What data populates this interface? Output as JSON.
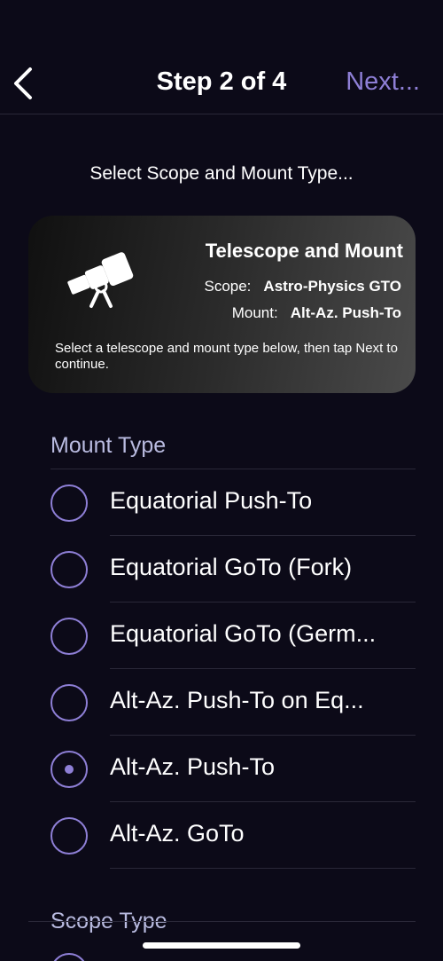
{
  "nav": {
    "title": "Step 2 of 4",
    "next_label": "Next..."
  },
  "subtitle": "Select Scope and Mount Type...",
  "card": {
    "icon": "telescope-icon",
    "title": "Telescope and Mount",
    "scope_label": "Scope:",
    "scope_value": "Astro-Physics GTO",
    "mount_label": "Mount:",
    "mount_value": "Alt-Az. Push-To",
    "note": "Select a telescope and mount type below, then tap Next to continue."
  },
  "mount_section": {
    "header": "Mount Type",
    "options": [
      {
        "label": "Equatorial Push-To",
        "selected": false
      },
      {
        "label": "Equatorial GoTo (Fork)",
        "selected": false
      },
      {
        "label": "Equatorial GoTo (Germ...",
        "selected": false
      },
      {
        "label": "Alt-Az. Push-To on Eq...",
        "selected": false
      },
      {
        "label": "Alt-Az. Push-To",
        "selected": true
      },
      {
        "label": "Alt-Az. GoTo",
        "selected": false
      }
    ]
  },
  "scope_section": {
    "header": "Scope Type"
  },
  "colors": {
    "background": "#0c0a18",
    "accent": "#8e7fd6",
    "section_header": "#b9bbe0"
  }
}
